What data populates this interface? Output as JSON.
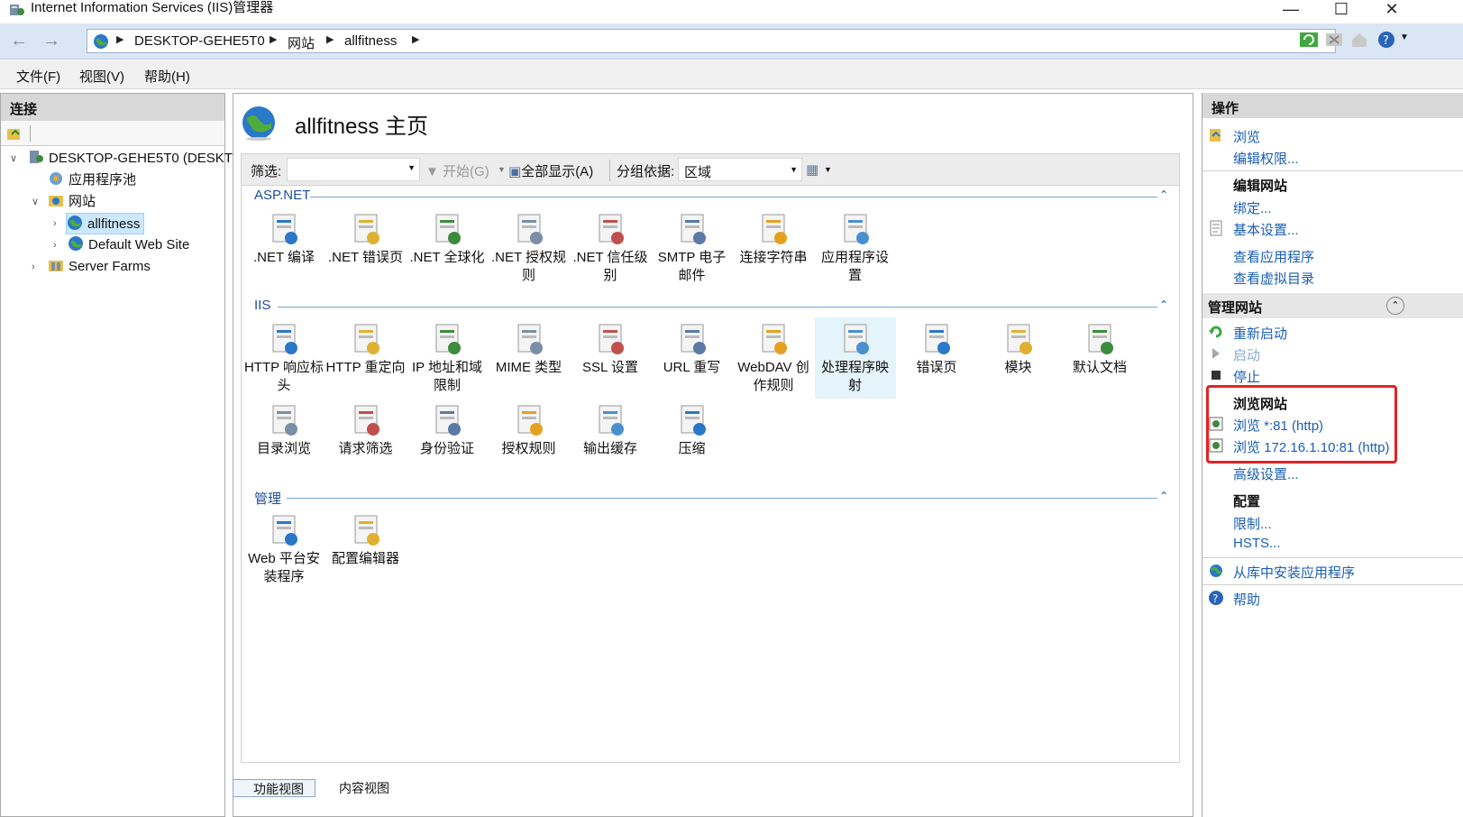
{
  "window": {
    "title": "Internet Information Services (IIS)管理器"
  },
  "address": {
    "crumbs": [
      "DESKTOP-GEHE5T0",
      "网站",
      "allfitness"
    ]
  },
  "menu": [
    "文件(F)",
    "视图(V)",
    "帮助(H)"
  ],
  "left": {
    "header": "连接",
    "tree": {
      "server": "DESKTOP-GEHE5T0 (DESKT",
      "app_pools": "应用程序池",
      "sites": "网站",
      "site1": "allfitness",
      "site2": "Default Web Site",
      "farms": "Server Farms"
    }
  },
  "center": {
    "title": "allfitness 主页",
    "filter": {
      "label": "筛选:",
      "start": "开始(G)",
      "show_all": "全部显示(A)",
      "group_by": "分组依据:",
      "group_value": "区域"
    },
    "groups": {
      "aspnet": "ASP.NET",
      "iis": "IIS",
      "manage": "管理"
    },
    "aspnet_features": [
      ".NET 编译",
      ".NET 错误页",
      ".NET 全球化",
      ".NET 授权规|则",
      ".NET 信任级|别",
      "SMTP 电子|邮件",
      "连接字符串",
      "应用程序设|置"
    ],
    "iis_features": [
      "HTTP 响应标|头",
      "HTTP 重定向",
      "IP 地址和域|限制",
      "MIME 类型",
      "SSL 设置",
      "URL 重写",
      "WebDAV 创|作规则",
      "处理程序映|射",
      "错误页",
      "模块",
      "默认文档",
      "目录浏览",
      "请求筛选",
      "身份验证",
      "授权规则",
      "输出缓存",
      "压缩"
    ],
    "manage_features": [
      "Web 平台安|装程序",
      "配置编辑器"
    ],
    "tabs": [
      "功能视图",
      "内容视图"
    ]
  },
  "right": {
    "header": "操作",
    "browse": "浏览",
    "edit_perms": "编辑权限...",
    "edit_site": "编辑网站",
    "bindings": "绑定...",
    "basic_settings": "基本设置...",
    "view_apps": "查看应用程序",
    "view_vdirs": "查看虚拟目录",
    "manage_site": "管理网站",
    "restart": "重新启动",
    "start": "启动",
    "stop": "停止",
    "browse_site": "浏览网站",
    "browse_81": "浏览 *:81 (http)",
    "browse_ip": "浏览 172.16.1.10:81 (http)",
    "advanced": "高级设置...",
    "config": "配置",
    "limits": "限制...",
    "hsts": "HSTS...",
    "install_gallery": "从库中安装应用程序",
    "help": "帮助"
  },
  "accent_color": "#1b5fb4",
  "highlight_color": "#e32222"
}
